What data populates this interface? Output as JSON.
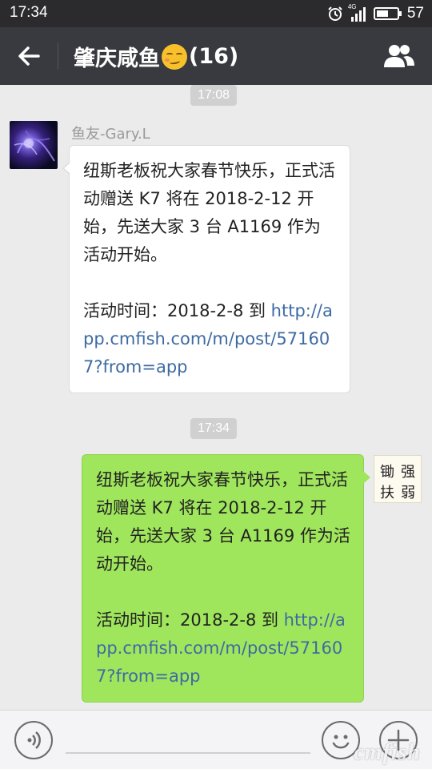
{
  "status_bar": {
    "time": "17:34",
    "network": "4G",
    "battery_percent": "57",
    "battery_level": 0.57,
    "icons": [
      "alarm-icon",
      "signal-icon",
      "battery-icon"
    ]
  },
  "header": {
    "title_prefix": "肇庆咸鱼",
    "title_emoji": "smirk-emoji",
    "title_suffix": "(16)",
    "icons": [
      "back-arrow-icon",
      "group-members-icon"
    ]
  },
  "messages": [
    {
      "timestamp": "17:08",
      "sender": "鱼友-Gary.L",
      "side": "left",
      "text": "纽斯老板祝大家春节快乐，正式活动赠送 K7 将在 2018-2-12 开始，先送大家 3 台 A1169 作为活动开始。\n\n活动时间：2018-2-8 到 ",
      "link": "http://app.cmfish.com/m/post/571607?from=app"
    },
    {
      "timestamp": "17:34",
      "side": "right",
      "text": "纽斯老板祝大家春节快乐，正式活动赠送 K7 将在 2018-2-12 开始，先送大家 3 台 A1169 作为活动开始。\n\n活动时间：2018-2-8 到 ",
      "link": "http://app.cmfish.com/m/post/571607?from=app",
      "avatar_text": [
        "锄",
        "强",
        "扶",
        "弱"
      ]
    }
  ],
  "input_bar": {
    "icons": [
      "voice-icon",
      "emoji-icon",
      "plus-icon"
    ]
  },
  "watermark": "cmfish",
  "colors": {
    "app_bar": "#393a3f",
    "status_bar": "#2b2b2d",
    "chat_background": "#ebebeb",
    "own_bubble": "#9fe65c",
    "other_bubble": "#ffffff",
    "link": "#3e6aa3"
  }
}
